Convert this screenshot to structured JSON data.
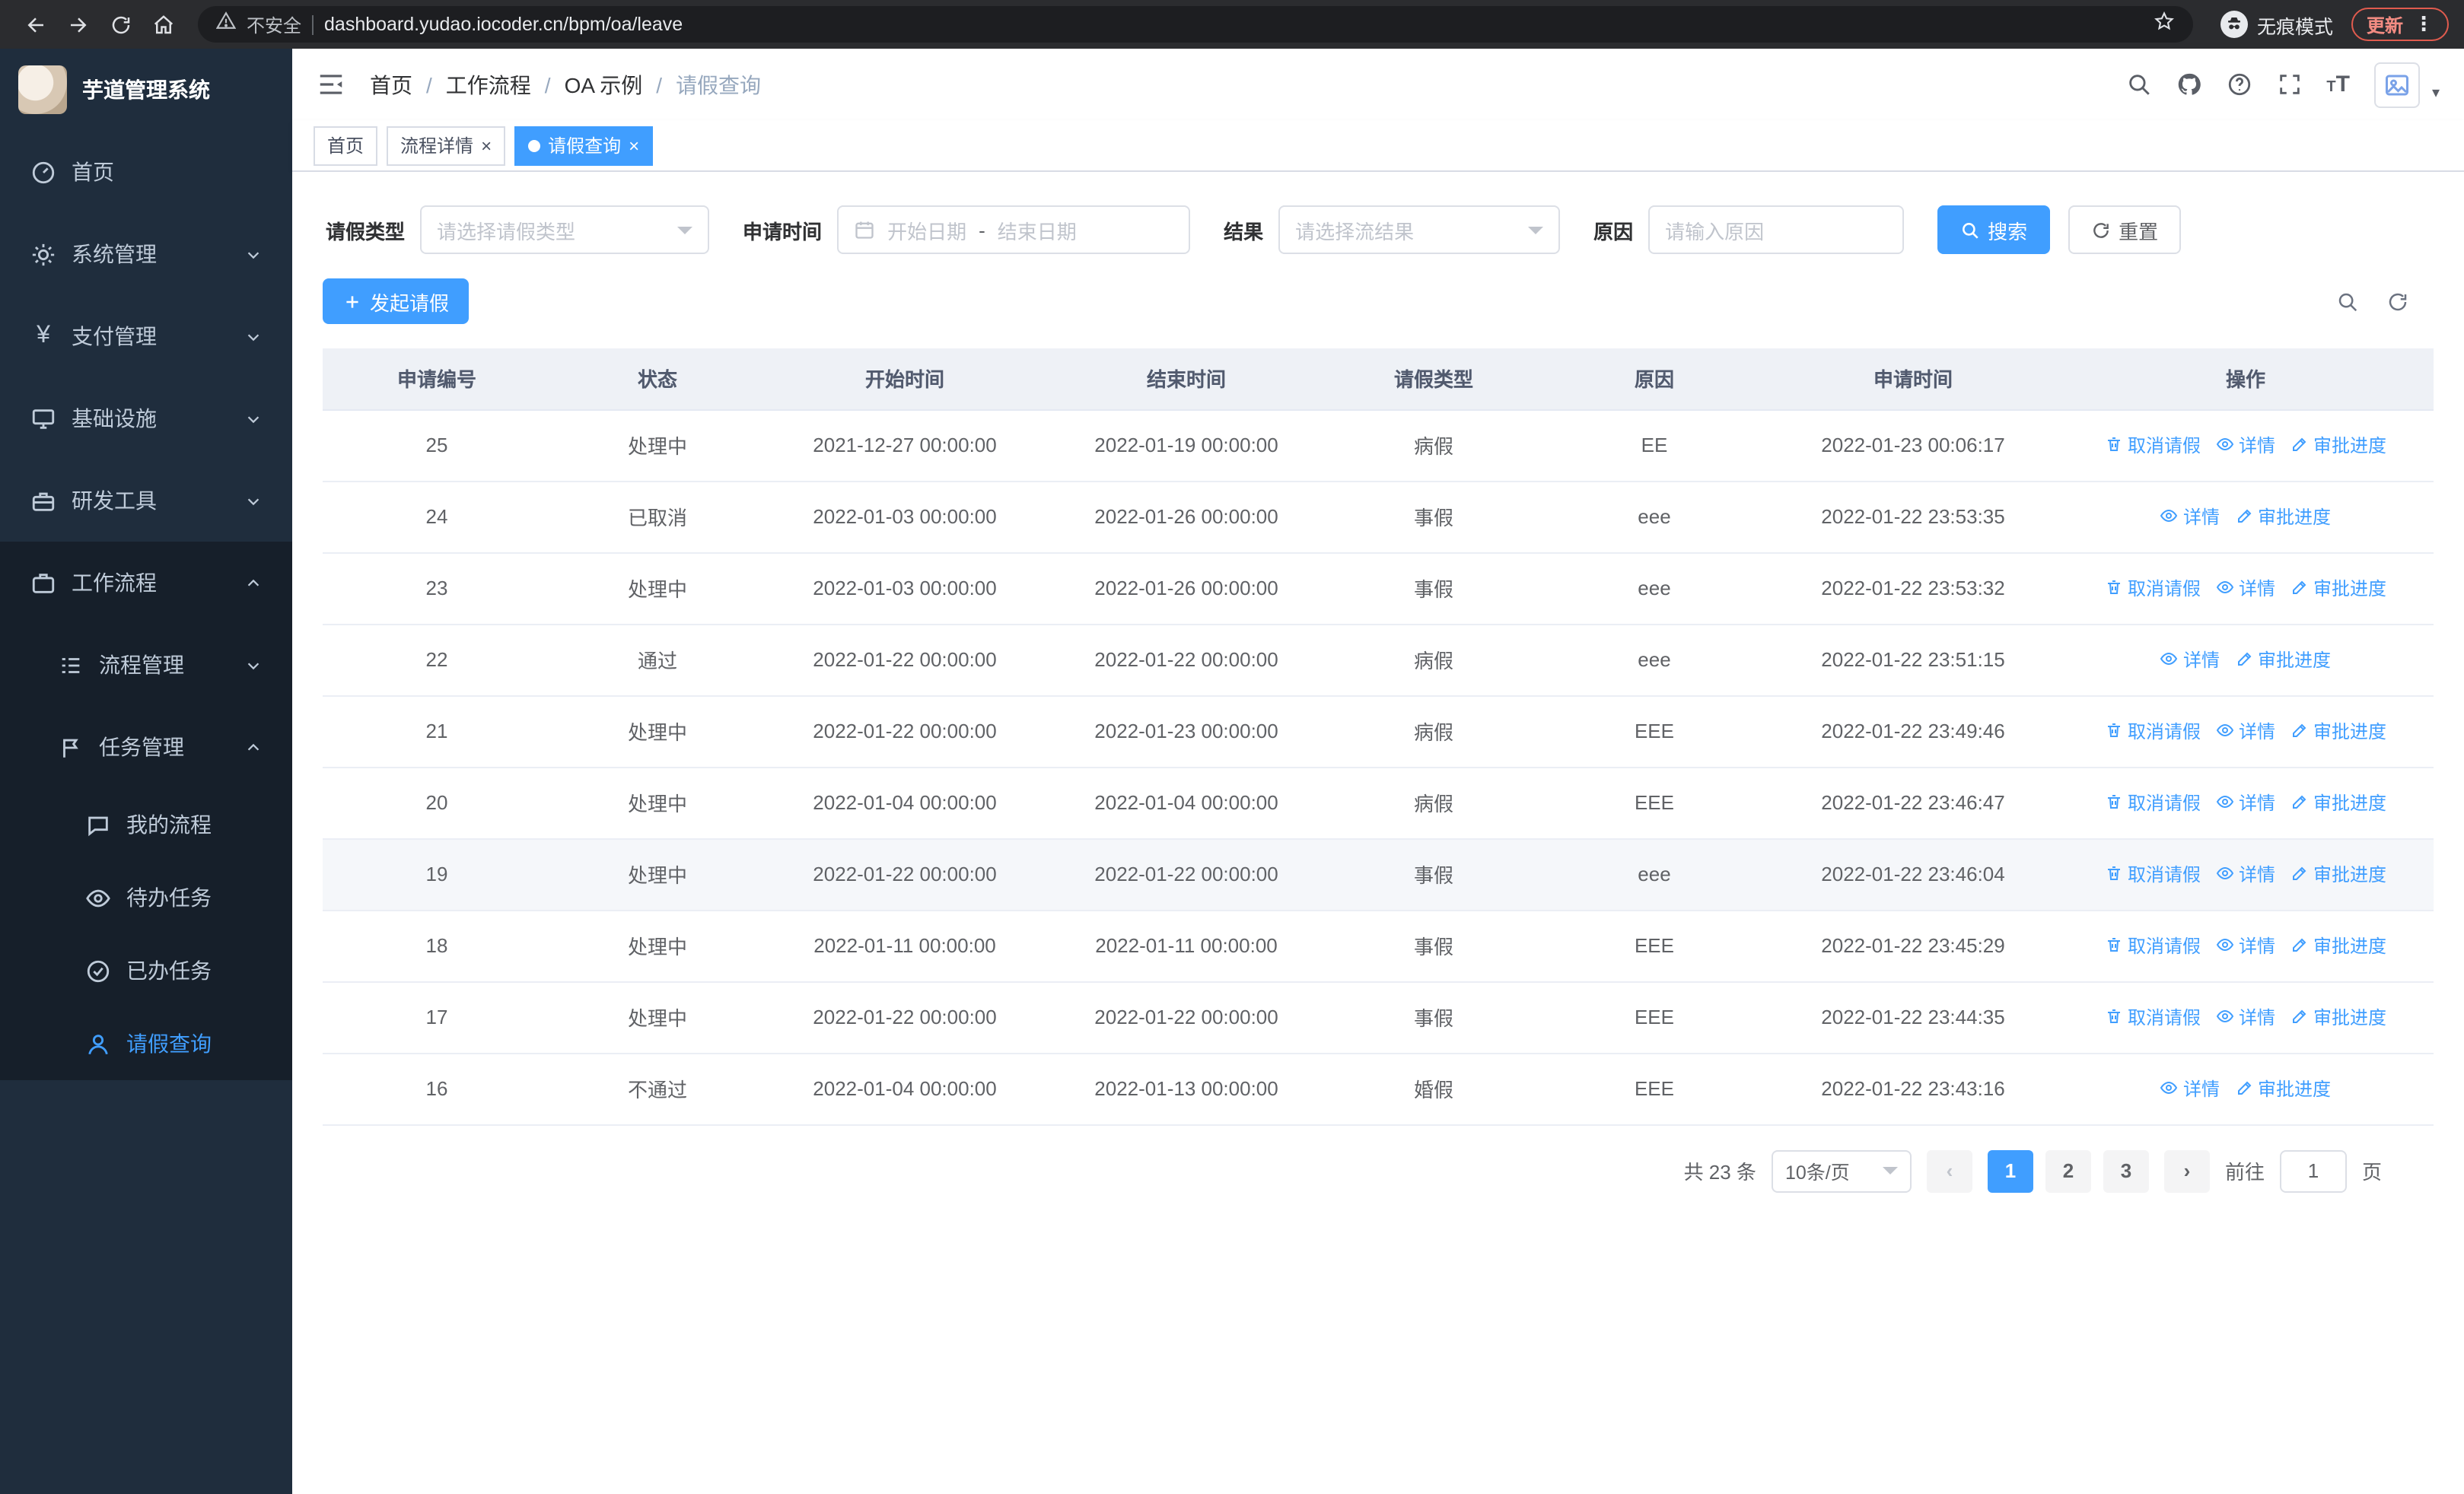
{
  "colors": {
    "accent": "#409eff",
    "sidebar_bg": "#1f2d3d",
    "submenu_bg": "#161f2a",
    "table_header_bg": "#eef1f6",
    "update_red": "#f28b82"
  },
  "browser": {
    "security_chip": "不安全",
    "url": "dashboard.yudao.iocoder.cn/bpm/oa/leave",
    "incognito_label": "无痕模式",
    "update_button": "更新",
    "menu_dots": "⋮"
  },
  "sidebar": {
    "logo_title": "芋道管理系统",
    "items": [
      {
        "label": "首页"
      },
      {
        "label": "系统管理"
      },
      {
        "label": "支付管理"
      },
      {
        "label": "基础设施"
      },
      {
        "label": "研发工具"
      },
      {
        "label": "工作流程"
      },
      {
        "label": "流程管理"
      },
      {
        "label": "任务管理"
      },
      {
        "label": "我的流程"
      },
      {
        "label": "待办任务"
      },
      {
        "label": "已办任务"
      },
      {
        "label": "请假查询"
      }
    ]
  },
  "navbar": {
    "dropdown_caret": "▾",
    "font_icon_big": "T",
    "font_icon_small": "T"
  },
  "breadcrumb": {
    "separator": "/",
    "items": [
      "首页",
      "工作流程",
      "OA 示例",
      "请假查询"
    ]
  },
  "tabs": {
    "close_glyph": "×",
    "items": [
      {
        "label": "首页"
      },
      {
        "label": "流程详情"
      },
      {
        "label": "请假查询"
      }
    ]
  },
  "filters": {
    "leave_type_label": "请假类型",
    "leave_type_placeholder": "请选择请假类型",
    "apply_time_label": "申请时间",
    "start_date_placeholder": "开始日期",
    "range_separator": "-",
    "end_date_placeholder": "结束日期",
    "result_label": "结果",
    "result_placeholder": "请选择流结果",
    "reason_label": "原因",
    "reason_placeholder": "请输入原因",
    "search_button": "搜索",
    "reset_button": "重置"
  },
  "toolbar": {
    "create_button": "发起请假"
  },
  "table": {
    "columns": [
      "申请编号",
      "状态",
      "开始时间",
      "结束时间",
      "请假类型",
      "原因",
      "申请时间",
      "操作"
    ],
    "actions": {
      "cancel": "取消请假",
      "detail": "详情",
      "progress": "审批进度"
    },
    "rows": [
      {
        "id": "25",
        "status": "处理中",
        "start": "2021-12-27 00:00:00",
        "end": "2022-01-19 00:00:00",
        "type": "病假",
        "reason": "EE",
        "applied": "2022-01-23 00:06:17",
        "cancelable": true,
        "highlighted": false
      },
      {
        "id": "24",
        "status": "已取消",
        "start": "2022-01-03 00:00:00",
        "end": "2022-01-26 00:00:00",
        "type": "事假",
        "reason": "eee",
        "applied": "2022-01-22 23:53:35",
        "cancelable": false,
        "highlighted": false
      },
      {
        "id": "23",
        "status": "处理中",
        "start": "2022-01-03 00:00:00",
        "end": "2022-01-26 00:00:00",
        "type": "事假",
        "reason": "eee",
        "applied": "2022-01-22 23:53:32",
        "cancelable": true,
        "highlighted": false
      },
      {
        "id": "22",
        "status": "通过",
        "start": "2022-01-22 00:00:00",
        "end": "2022-01-22 00:00:00",
        "type": "病假",
        "reason": "eee",
        "applied": "2022-01-22 23:51:15",
        "cancelable": false,
        "highlighted": false
      },
      {
        "id": "21",
        "status": "处理中",
        "start": "2022-01-22 00:00:00",
        "end": "2022-01-23 00:00:00",
        "type": "病假",
        "reason": "EEE",
        "applied": "2022-01-22 23:49:46",
        "cancelable": true,
        "highlighted": false
      },
      {
        "id": "20",
        "status": "处理中",
        "start": "2022-01-04 00:00:00",
        "end": "2022-01-04 00:00:00",
        "type": "病假",
        "reason": "EEE",
        "applied": "2022-01-22 23:46:47",
        "cancelable": true,
        "highlighted": false
      },
      {
        "id": "19",
        "status": "处理中",
        "start": "2022-01-22 00:00:00",
        "end": "2022-01-22 00:00:00",
        "type": "事假",
        "reason": "eee",
        "applied": "2022-01-22 23:46:04",
        "cancelable": true,
        "highlighted": true
      },
      {
        "id": "18",
        "status": "处理中",
        "start": "2022-01-11 00:00:00",
        "end": "2022-01-11 00:00:00",
        "type": "事假",
        "reason": "EEE",
        "applied": "2022-01-22 23:45:29",
        "cancelable": true,
        "highlighted": false
      },
      {
        "id": "17",
        "status": "处理中",
        "start": "2022-01-22 00:00:00",
        "end": "2022-01-22 00:00:00",
        "type": "事假",
        "reason": "EEE",
        "applied": "2022-01-22 23:44:35",
        "cancelable": true,
        "highlighted": false
      },
      {
        "id": "16",
        "status": "不通过",
        "start": "2022-01-04 00:00:00",
        "end": "2022-01-13 00:00:00",
        "type": "婚假",
        "reason": "EEE",
        "applied": "2022-01-22 23:43:16",
        "cancelable": false,
        "highlighted": false
      }
    ]
  },
  "pagination": {
    "total": "共 23 条",
    "page_size": "10条/页",
    "prev_glyph": "‹",
    "next_glyph": "›",
    "pages": [
      "1",
      "2",
      "3"
    ],
    "active_page": "1",
    "goto_label": "前往",
    "goto_value": "1",
    "page_label": "页"
  }
}
